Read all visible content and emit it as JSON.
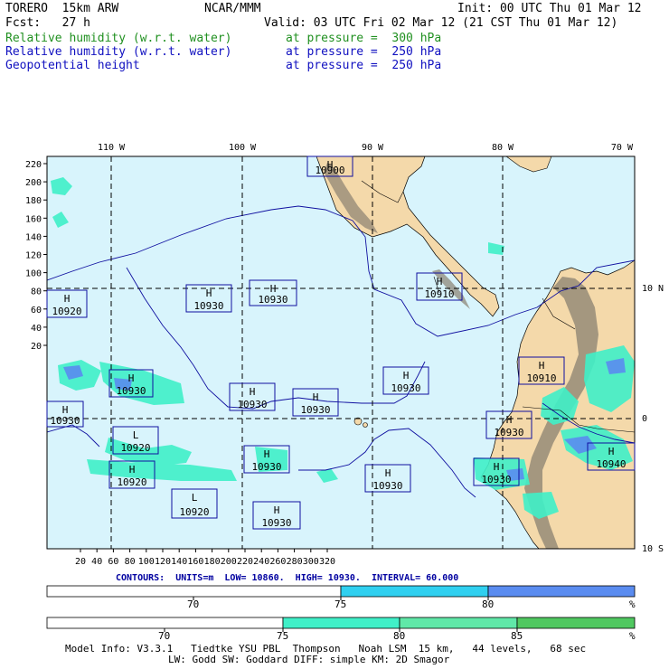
{
  "header": {
    "model": "TORERO  15km ARW",
    "org": "NCAR/MMM",
    "init": "Init: 00 UTC Thu 01 Mar 12",
    "fcst": "Fcst:   27 h",
    "valid": "Valid: 03 UTC Fri 02 Mar 12 (21 CST Thu 01 Mar 12)"
  },
  "fields": [
    {
      "name": "Relative humidity (w.r.t. water)",
      "level": "at pressure =  300 hPa",
      "color": "#209020"
    },
    {
      "name": "Relative humidity (w.r.t. water)",
      "level": "at pressure =  250 hPa",
      "color": "#1010c0"
    },
    {
      "name": "Geopotential height",
      "level": "at pressure =  250 hPa",
      "color": "#1010c0"
    }
  ],
  "map": {
    "lon_labels": [
      "110 W",
      "100 W",
      "90 W",
      "80 W",
      "70 W"
    ],
    "lat_labels": [
      "10 N",
      "0",
      "10 S"
    ],
    "y_grid_labels": [
      "220",
      "200",
      "180",
      "160",
      "140",
      "120",
      "100",
      "80",
      "60",
      "40",
      "20"
    ],
    "x_grid_labels": [
      "20",
      "40",
      "60",
      "80",
      "100",
      "120",
      "140",
      "160",
      "180",
      "200",
      "220",
      "240",
      "260",
      "280",
      "300",
      "320"
    ],
    "colors": {
      "ocean": "#d8f4fc",
      "land": "#f4d9aa",
      "mountain": "#8a8070",
      "rh300": "#40f0c8",
      "rh250": "#5a8cf0",
      "contour": "#1010a0"
    },
    "centers": [
      {
        "type": "H",
        "value": "10900"
      },
      {
        "type": "H",
        "value": "10920"
      },
      {
        "type": "H",
        "value": "10930"
      },
      {
        "type": "H",
        "value": "10930"
      },
      {
        "type": "H",
        "value": "10910"
      },
      {
        "type": "H",
        "value": "10910"
      },
      {
        "type": "H",
        "value": "10930"
      },
      {
        "type": "H",
        "value": "10930"
      },
      {
        "type": "H",
        "value": "10930"
      },
      {
        "type": "H",
        "value": "10930"
      },
      {
        "type": "H",
        "value": "10930"
      },
      {
        "type": "L",
        "value": "10920"
      },
      {
        "type": "H",
        "value": "10930"
      },
      {
        "type": "H",
        "value": "10940"
      },
      {
        "type": "H",
        "value": "10930"
      },
      {
        "type": "H",
        "value": "10920"
      },
      {
        "type": "H",
        "value": "10930"
      },
      {
        "type": "H",
        "value": "10930"
      },
      {
        "type": "L",
        "value": "10920"
      },
      {
        "type": "H",
        "value": "10930"
      }
    ]
  },
  "contours_info": {
    "label": "CONTOURS:",
    "units": "UNITS=m",
    "low": "LOW=  10860.",
    "high": "HIGH=  10930.",
    "interval": "INTERVAL=   60.000"
  },
  "colorbar_250": {
    "labels": [
      "70",
      "75",
      "80",
      "%"
    ],
    "colors": [
      "#ffffff",
      "#30d0f0",
      "#5a8cf0"
    ]
  },
  "colorbar_300": {
    "labels": [
      "70",
      "75",
      "80",
      "85",
      "%"
    ],
    "colors": [
      "#ffffff",
      "#40f0c8",
      "#60e8a8",
      "#50c860"
    ]
  },
  "footer": {
    "line1": "Model Info: V3.3.1   Tiedtke YSU PBL  Thompson   Noah LSM  15 km,   44 levels,   68 sec",
    "line2": "LW: Godd SW: Goddard DIFF: simple KM: 2D Smagor"
  }
}
